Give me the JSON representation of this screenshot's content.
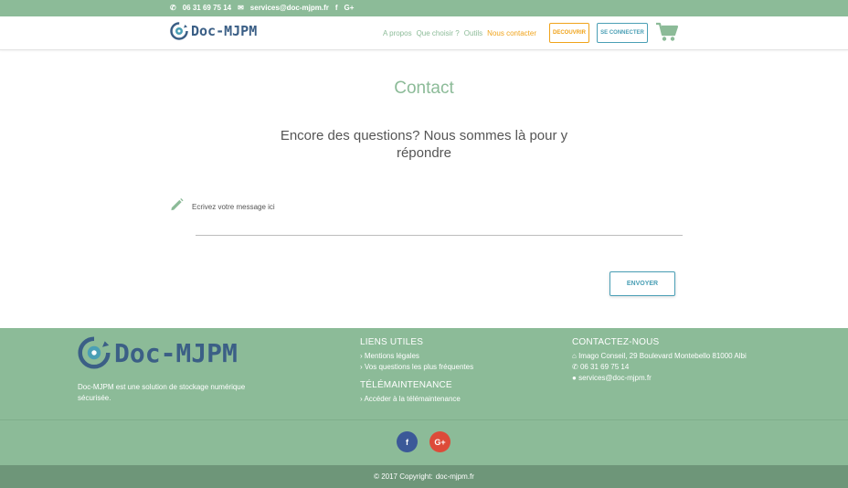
{
  "topbar": {
    "phone": "06 31 69 75 14",
    "email": "services@doc-mjpm.fr",
    "facebook": "f",
    "googleplus": "G+"
  },
  "header": {
    "logo_text": "Doc-MJPM",
    "nav": [
      {
        "label": "A propos"
      },
      {
        "label": "Que choisir ?"
      },
      {
        "label": "Outils"
      },
      {
        "label": "Nous contacter"
      }
    ],
    "discover_label": "DECOUVRIR",
    "connect_label": "SE CONNECTER"
  },
  "main": {
    "title": "Contact",
    "subtitle": "Encore des questions? Nous sommes là pour y répondre",
    "message_placeholder": "Ecrivez votre message ici",
    "send_label": "ENVOYER"
  },
  "footer": {
    "logo_text": "Doc-MJPM",
    "description": "Doc-MJPM est une solution de stockage numérique sécurisée.",
    "useful_links_title": "LIENS UTILES",
    "useful_links": [
      "Mentions légales",
      "Vos questions les plus fréquentes"
    ],
    "telemaintenance_title": "TÉLÉMAINTENANCE",
    "telemaintenance_link": "Accéder à la télémaintenance",
    "contact_title": "CONTACTEZ-NOUS",
    "address": "Imago Conseil, 29 Boulevard Montebello 81000 Albi",
    "phone": "06 31 69 75 14",
    "email": "services@doc-mjpm.fr",
    "social_fb": "f",
    "social_gp": "G+",
    "copyright_prefix": "© 2017 Copyright:",
    "copyright_site": "doc-mjpm.fr"
  },
  "colors": {
    "brand_green": "#8cbb98",
    "accent_orange": "#f0a31a",
    "accent_teal": "#4a9fb5",
    "logo_blue": "#3b5f86",
    "facebook_blue": "#3b5998",
    "google_red": "#dd4b39"
  }
}
